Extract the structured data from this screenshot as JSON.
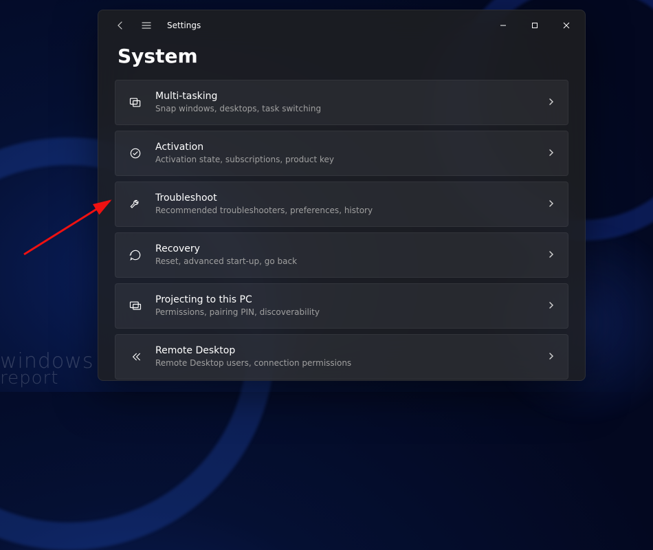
{
  "app_title": "Settings",
  "page_title": "System",
  "watermark_line1": "windows",
  "watermark_line2": "report",
  "items": [
    {
      "icon": "multitasking-icon",
      "title": "Multi-tasking",
      "desc": "Snap windows, desktops, task switching"
    },
    {
      "icon": "activation-icon",
      "title": "Activation",
      "desc": "Activation state, subscriptions, product key"
    },
    {
      "icon": "troubleshoot-icon",
      "title": "Troubleshoot",
      "desc": "Recommended troubleshooters, preferences, history"
    },
    {
      "icon": "recovery-icon",
      "title": "Recovery",
      "desc": "Reset, advanced start-up, go back"
    },
    {
      "icon": "projecting-icon",
      "title": "Projecting to this PC",
      "desc": "Permissions, pairing PIN, discoverability"
    },
    {
      "icon": "remote-desktop-icon",
      "title": "Remote Desktop",
      "desc": "Remote Desktop users, connection permissions"
    }
  ]
}
